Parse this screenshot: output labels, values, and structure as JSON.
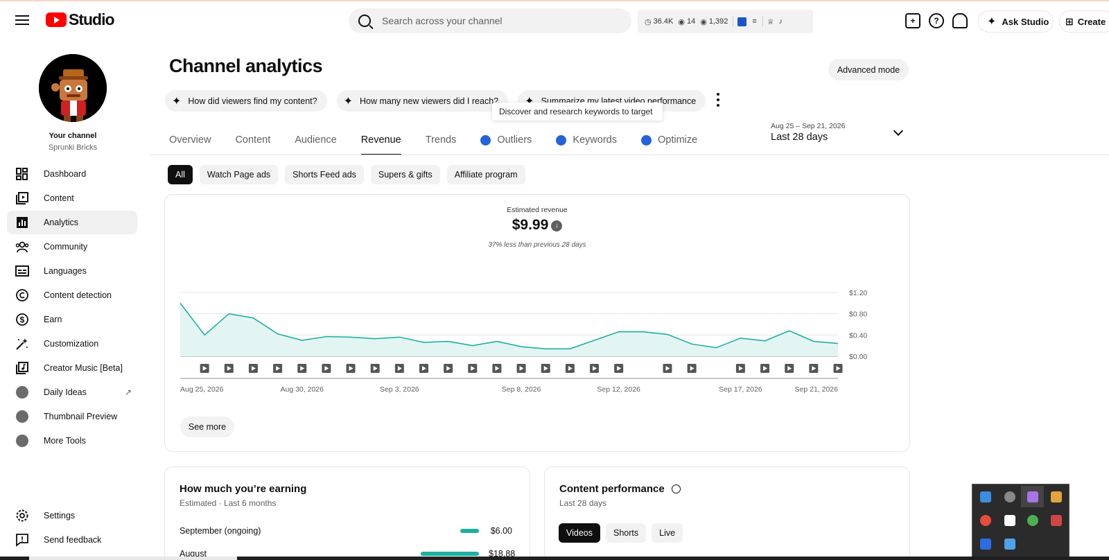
{
  "header": {
    "logo_text": "Studio",
    "search_placeholder": "Search across your channel",
    "stats": {
      "watch_hours": "36.4K",
      "live_viewers": "14",
      "views": "1,392"
    },
    "ask_studio_label": "Ask Studio",
    "create_label": "Create"
  },
  "sidebar": {
    "channel_label": "Your channel",
    "channel_name": "Sprunki Bricks",
    "items": [
      {
        "label": "Dashboard",
        "icon": "dashboard-icon"
      },
      {
        "label": "Content",
        "icon": "content-icon"
      },
      {
        "label": "Analytics",
        "icon": "analytics-icon",
        "active": true
      },
      {
        "label": "Community",
        "icon": "community-icon"
      },
      {
        "label": "Languages",
        "icon": "languages-icon"
      },
      {
        "label": "Content detection",
        "icon": "copyright-icon"
      },
      {
        "label": "Earn",
        "icon": "dollar-icon"
      },
      {
        "label": "Customization",
        "icon": "magic-wand-icon"
      },
      {
        "label": "Creator Music [Beta]",
        "icon": "music-icon"
      },
      {
        "label": "Daily Ideas",
        "icon": "vidiq-icon"
      },
      {
        "label": "Thumbnail Preview",
        "icon": "vidiq-icon"
      },
      {
        "label": "More Tools",
        "icon": "vidiq-icon"
      }
    ],
    "bottom_items": [
      {
        "label": "Settings",
        "icon": "gear-icon"
      },
      {
        "label": "Send feedback",
        "icon": "feedback-icon"
      }
    ]
  },
  "main": {
    "title": "Channel analytics",
    "advanced_mode": "Advanced mode",
    "questions": [
      "How did viewers find my content?",
      "How many new viewers did I reach?",
      "Summarize my latest video performance"
    ],
    "tooltip": "Discover and research keywords to target",
    "tabs": [
      "Overview",
      "Content",
      "Audience",
      "Revenue",
      "Trends",
      "Outliers",
      "Keywords",
      "Optimize"
    ],
    "active_tab": "Revenue",
    "date_range_dates": "Aug 25 – Sep 21, 2026",
    "date_range_label": "Last 28 days",
    "filters": [
      "All",
      "Watch Page ads",
      "Shorts Feed ads",
      "Supers & gifts",
      "Affiliate program"
    ],
    "revenue": {
      "label": "Estimated revenue",
      "value": "$9.99",
      "compare": "37% less than previous 28 days",
      "see_more": "See more"
    },
    "earning": {
      "title": "How much you’re earning",
      "subtitle": "Estimated · Last 6 months",
      "rows": [
        {
          "label": "September (ongoing)",
          "amount": "$6.00",
          "fraction": 0.32
        },
        {
          "label": "August",
          "amount": "$18.88",
          "fraction": 1.0
        }
      ]
    },
    "performance": {
      "title": "Content performance",
      "subtitle": "Last 28 days",
      "tabs": [
        "Videos",
        "Shorts",
        "Live"
      ]
    }
  },
  "chart_data": {
    "type": "area",
    "x": [
      "Aug 25",
      "Aug 26",
      "Aug 27",
      "Aug 28",
      "Aug 29",
      "Aug 30",
      "Aug 31",
      "Sep 1",
      "Sep 2",
      "Sep 3",
      "Sep 4",
      "Sep 5",
      "Sep 6",
      "Sep 7",
      "Sep 8",
      "Sep 9",
      "Sep 10",
      "Sep 11",
      "Sep 12",
      "Sep 13",
      "Sep 14",
      "Sep 15",
      "Sep 16",
      "Sep 17",
      "Sep 18",
      "Sep 19",
      "Sep 20",
      "Sep 21"
    ],
    "series": [
      {
        "values": [
          1.0,
          0.4,
          0.8,
          0.72,
          0.42,
          0.3,
          0.37,
          0.36,
          0.33,
          0.36,
          0.26,
          0.28,
          0.2,
          0.28,
          0.18,
          0.14,
          0.14,
          0.3,
          0.46,
          0.46,
          0.41,
          0.23,
          0.16,
          0.34,
          0.29,
          0.48,
          0.28,
          0.24
        ]
      }
    ],
    "x_tick_labels": [
      "Aug 25, 2026",
      "Aug 30, 2026",
      "Sep 3, 2026",
      "Sep 8, 2026",
      "Sep 12, 2026",
      "Sep 17, 2026",
      "Sep 21, 2026"
    ],
    "x_tick_index": [
      0,
      5,
      9,
      14,
      18,
      23,
      27
    ],
    "y_tick_labels": [
      "$1.20",
      "$0.80",
      "$0.40",
      "$0.00"
    ],
    "ylim": [
      0,
      1.2
    ],
    "video_markers_index": [
      1,
      2,
      3,
      4,
      5,
      6,
      7,
      8,
      9,
      10,
      11,
      12,
      13,
      14,
      15,
      16,
      17,
      18,
      20,
      21,
      23,
      24,
      25,
      26,
      27
    ],
    "grid": true,
    "colors": {
      "line": "#1db0a0",
      "fill": "#e3f5f3"
    }
  }
}
